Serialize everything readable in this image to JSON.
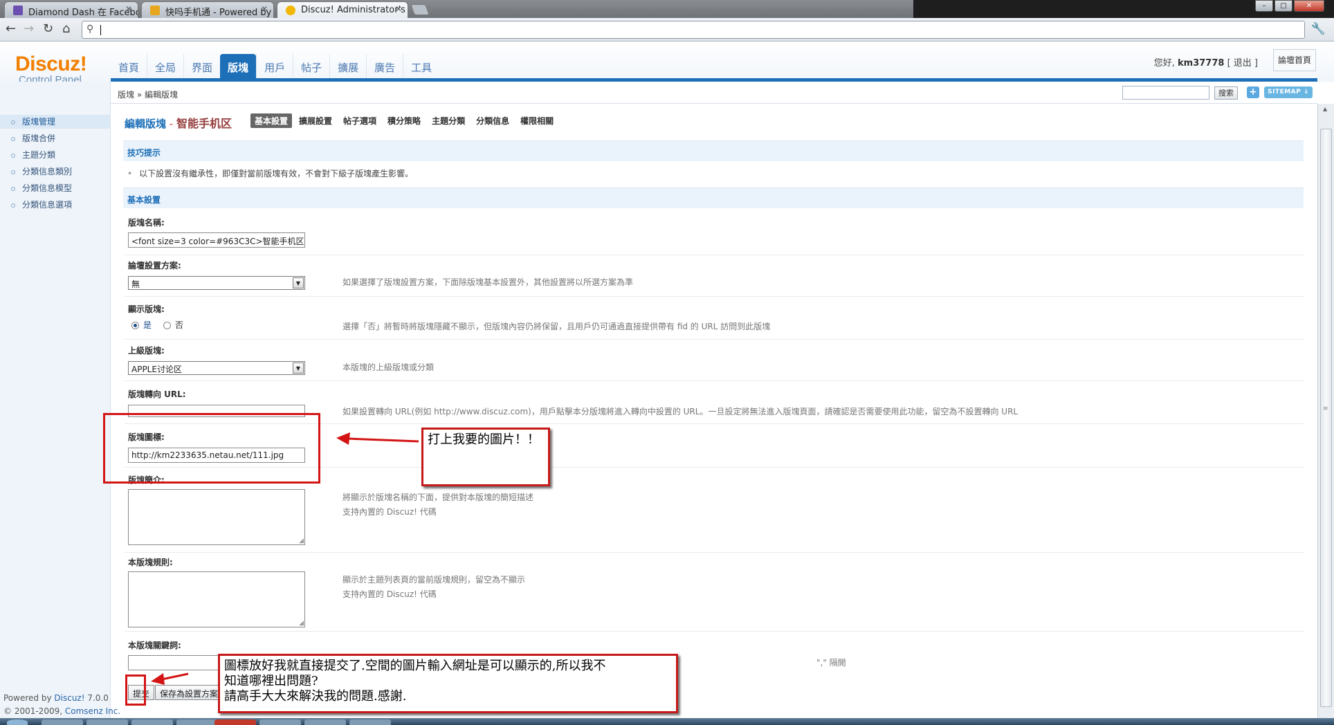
{
  "browser": {
    "tabs": [
      {
        "title": "Diamond Dash 在 Facebo",
        "active": false
      },
      {
        "title": "快吗手机通 - Powered by I",
        "active": false
      },
      {
        "title": "Discuz! Administrator's Co",
        "active": true
      }
    ],
    "window_buttons": {
      "minimize": "–",
      "maximize": "□",
      "close": "✕"
    },
    "address": ""
  },
  "header": {
    "logo_name": "Discuz!",
    "logo_sub": "Control Panel",
    "nav": [
      "首頁",
      "全局",
      "界面",
      "版塊",
      "用戶",
      "帖子",
      "擴展",
      "廣告",
      "工具"
    ],
    "nav_active": "版塊",
    "greeting": "您好,",
    "username": "km37778",
    "logout": "[ 退出 ]",
    "home_button": "論壇首頁"
  },
  "breadcrumb": {
    "text": "版塊 » 編輯版塊",
    "search_button": "搜索",
    "plus": "+",
    "sitemap": "SITEMAP ↓"
  },
  "sidebar": {
    "items": [
      "版塊管理",
      "版塊合併",
      "主題分類",
      "分類信息類別",
      "分類信息模型",
      "分類信息選項"
    ],
    "active": "版塊管理",
    "footer_line1_prefix": "Powered by",
    "footer_brand": "Discuz!",
    "footer_version": "7.0.0",
    "footer_line2": "© 2001-2009,",
    "footer_company": "Comsenz Inc."
  },
  "content": {
    "title_label": "編輯版塊",
    "title_sep": " - ",
    "forum_name": "智能手机区",
    "tabs": [
      "基本設置",
      "擴展設置",
      "帖子選項",
      "積分策略",
      "主題分類",
      "分類信息",
      "權限相關"
    ],
    "active_tab": "基本設置",
    "tips_heading": "技巧提示",
    "tip_text": "以下設置沒有繼承性，即僅對當前版塊有效，不會對下級子版塊產生影響。",
    "basic_heading": "基本設置",
    "fields": {
      "name_label": "版塊名稱:",
      "name_value": "<font size=3 color=#963C3C>智能手机区",
      "scheme_label": "論壇設置方案:",
      "scheme_value": "無",
      "scheme_hint": "如果選擇了版塊設置方案，下面除版塊基本設置外，其他設置將以所選方案為準",
      "display_label": "顯示版塊:",
      "display_yes": "是",
      "display_no": "否",
      "display_hint": "選擇「否」將暫時將版塊隱藏不顯示，但版塊內容仍將保留，且用戶仍可通過直接提供帶有 fid 的 URL 訪問到此版塊",
      "parent_label": "上級版塊:",
      "parent_value": "APPLE讨论区",
      "parent_hint": "本版塊的上級版塊或分類",
      "redirect_label": "版塊轉向 URL:",
      "redirect_value": "",
      "redirect_hint": "如果設置轉向 URL(例如 http://www.discuz.com)，用戶點擊本分版塊將進入轉向中設置的 URL。一旦設定將無法進入版塊頁面，請確認是否需要使用此功能，留空為不設置轉向 URL",
      "icon_label": "版塊圖標:",
      "icon_value": "http://km2233635.netau.net/111.jpg",
      "intro_label": "版塊簡介:",
      "intro_hint1": "將顯示於版塊名稱的下面，提供對本版塊的簡短描述",
      "intro_hint2": "支持內置的 Discuz! 代碼",
      "rules_label": "本版塊規則:",
      "rules_hint1": "顯示於主題列表頁的當前版塊規則，留空為不顯示",
      "rules_hint2": "支持內置的 Discuz! 代碼",
      "keywords_label": "本版塊關鍵詞:",
      "keywords_hint": "\",\" 隔開"
    },
    "submit_button": "提交",
    "save_scheme_button": "保存為設置方案"
  },
  "annotations": {
    "callout1": "打上我要的圖片！！",
    "callout2_line1": "圖標放好我就直接提交了.空間的圖片輸入網址是可以顯示的,所以我不",
    "callout2_line2": "知道哪裡出問題?",
    "callout2_line3": "請高手大大來解決我的問題.感謝."
  },
  "colors": {
    "accent": "#1d6fb8",
    "forum_name": "#963c3c",
    "logo": "#f27f00",
    "annotation_red": "#d31414"
  }
}
